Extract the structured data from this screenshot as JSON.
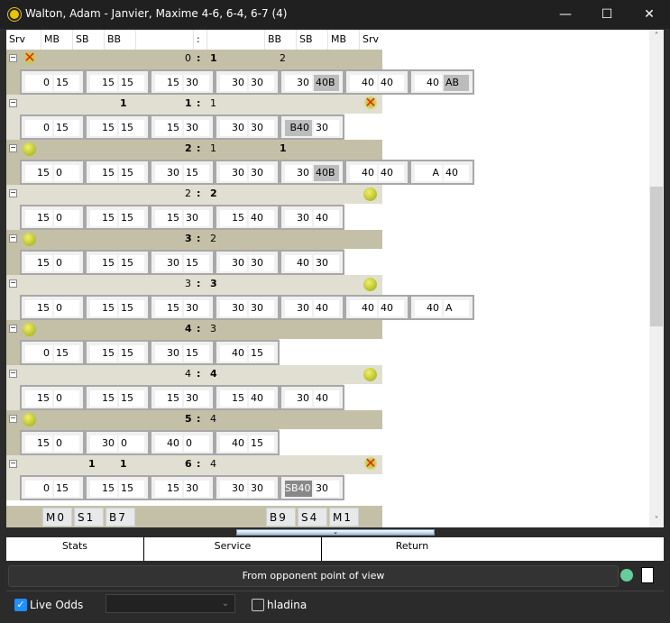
{
  "window": {
    "title": "Walton, Adam - Janvier, Maxime 4-6, 6-4, 6-7 (4)",
    "minimize": "—",
    "maximize": "☐",
    "close": "✕"
  },
  "columns": [
    "Srv",
    "MB",
    "SB",
    "BB",
    ":",
    "BB",
    "SB",
    "MB",
    "Srv"
  ],
  "games": [
    {
      "shade": "dark",
      "left_icon": "x-icon",
      "right_icon": "",
      "a": "0",
      "b": "1",
      "bold": "b",
      "marks": [
        {
          "col": "rBB",
          "v": "2",
          "bold": false
        }
      ],
      "points": [
        [
          "0",
          "15"
        ],
        [
          "15",
          "15"
        ],
        [
          "15",
          "30"
        ],
        [
          "30",
          "30"
        ],
        [
          "30",
          "40B",
          "g2"
        ],
        [
          "40",
          "40"
        ],
        [
          "40",
          "AB",
          "g2"
        ]
      ]
    },
    {
      "shade": "light",
      "left_icon": "",
      "right_icon": "x-icon",
      "a": "1",
      "b": "1",
      "bold": "a",
      "marks": [
        {
          "col": "lBB",
          "v": "1",
          "bold": true
        }
      ],
      "points": [
        [
          "0",
          "15"
        ],
        [
          "15",
          "15"
        ],
        [
          "15",
          "30"
        ],
        [
          "30",
          "30"
        ],
        [
          "B40",
          "30",
          "g1"
        ]
      ]
    },
    {
      "shade": "dark",
      "left_icon": "ball-icon",
      "right_icon": "",
      "a": "2",
      "b": "1",
      "bold": "a",
      "marks": [
        {
          "col": "rBB",
          "v": "1",
          "bold": true
        }
      ],
      "points": [
        [
          "15",
          "0"
        ],
        [
          "15",
          "15"
        ],
        [
          "30",
          "15"
        ],
        [
          "30",
          "30"
        ],
        [
          "30",
          "40B",
          "g2"
        ],
        [
          "40",
          "40"
        ],
        [
          "A",
          "40"
        ]
      ]
    },
    {
      "shade": "light",
      "left_icon": "",
      "right_icon": "ball-icon",
      "a": "2",
      "b": "2",
      "bold": "b",
      "marks": [],
      "points": [
        [
          "15",
          "0"
        ],
        [
          "15",
          "15"
        ],
        [
          "15",
          "30"
        ],
        [
          "15",
          "40"
        ],
        [
          "30",
          "40"
        ]
      ]
    },
    {
      "shade": "dark",
      "left_icon": "ball-icon",
      "right_icon": "",
      "a": "3",
      "b": "2",
      "bold": "a",
      "marks": [],
      "points": [
        [
          "15",
          "0"
        ],
        [
          "15",
          "15"
        ],
        [
          "30",
          "15"
        ],
        [
          "30",
          "30"
        ],
        [
          "40",
          "30"
        ]
      ]
    },
    {
      "shade": "light",
      "left_icon": "",
      "right_icon": "ball-icon",
      "a": "3",
      "b": "3",
      "bold": "b",
      "marks": [],
      "points": [
        [
          "15",
          "0"
        ],
        [
          "15",
          "15"
        ],
        [
          "15",
          "30"
        ],
        [
          "30",
          "30"
        ],
        [
          "30",
          "40"
        ],
        [
          "40",
          "40"
        ],
        [
          "40",
          "A"
        ]
      ]
    },
    {
      "shade": "dark",
      "left_icon": "ball-icon",
      "right_icon": "",
      "a": "4",
      "b": "3",
      "bold": "a",
      "marks": [],
      "points": [
        [
          "0",
          "15"
        ],
        [
          "15",
          "15"
        ],
        [
          "30",
          "15"
        ],
        [
          "40",
          "15"
        ]
      ]
    },
    {
      "shade": "light",
      "left_icon": "",
      "right_icon": "ball-icon",
      "a": "4",
      "b": "4",
      "bold": "b",
      "marks": [],
      "points": [
        [
          "15",
          "0"
        ],
        [
          "15",
          "15"
        ],
        [
          "15",
          "30"
        ],
        [
          "15",
          "40"
        ],
        [
          "30",
          "40"
        ]
      ]
    },
    {
      "shade": "dark",
      "left_icon": "ball-icon",
      "right_icon": "",
      "a": "5",
      "b": "4",
      "bold": "a",
      "marks": [],
      "points": [
        [
          "15",
          "0"
        ],
        [
          "30",
          "0"
        ],
        [
          "40",
          "0"
        ],
        [
          "40",
          "15"
        ]
      ]
    },
    {
      "shade": "light",
      "left_icon": "",
      "right_icon": "x-icon",
      "a": "6",
      "b": "4",
      "bold": "a",
      "marks": [
        {
          "col": "lSB",
          "v": "1",
          "bold": true
        },
        {
          "col": "lBB",
          "v": "1",
          "bold": true
        }
      ],
      "points": [
        [
          "0",
          "15"
        ],
        [
          "15",
          "15"
        ],
        [
          "15",
          "30"
        ],
        [
          "30",
          "30"
        ],
        [
          "SB40",
          "30",
          "d1"
        ]
      ]
    }
  ],
  "totals": {
    "left": [
      "M0",
      "S1",
      "B7"
    ],
    "right": [
      "B9",
      "S4",
      "M1"
    ]
  },
  "stats_header": {
    "stats": "Stats",
    "service": "Service",
    "return": "Return"
  },
  "opponent_view_button": "From opponent point of view",
  "live_odds": {
    "label": "Live Odds",
    "checked": true
  },
  "odds_select": {
    "value": ""
  },
  "hladina": {
    "label": "hladina",
    "checked": false
  },
  "colors": {
    "dark_row": "#c4c0a8",
    "light_row": "#e1dfd2",
    "accent": "#1e90ff"
  }
}
